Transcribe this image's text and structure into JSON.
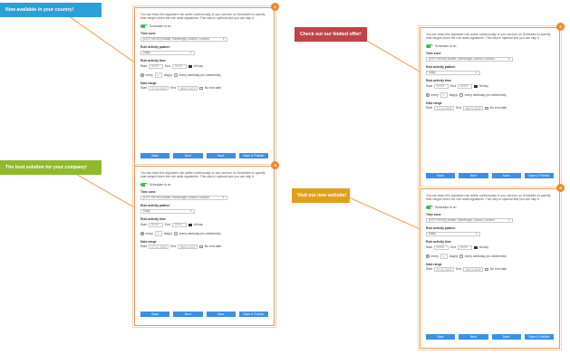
{
  "banners": [
    {
      "text": "Now available in your country!",
      "color": "#2a9fd8"
    },
    {
      "text": "Check out our limited offer!",
      "color": "#c0424a"
    },
    {
      "text": "The best solution for your company!",
      "color": "#8dbb2c"
    },
    {
      "text": "Visit our new website!",
      "color": "#e0a11a"
    }
  ],
  "accent_color": "#f08a24",
  "panels": [
    {
      "badge": "1"
    },
    {
      "badge": "2"
    },
    {
      "badge": "3"
    },
    {
      "badge": "4"
    }
  ],
  "form": {
    "intro": "You can keep this signature rule active continuously or you can turn on Scheduler to specify time ranges when the rule adds signatures. This step is optional and you can skip it.",
    "scheduler_label": "Scheduler is on",
    "timezone_label": "Time zone",
    "timezone_value": "(UTC+00:00) Dublin, Edinburgh, Lisbon, London",
    "pattern_label": "Rule activity pattern",
    "pattern_value": "Daily",
    "time_label": "Rule activity time",
    "start_label": "Start",
    "start_time": "00:00",
    "end_label": "End",
    "end_time": "00:00",
    "all_day_label": "All day",
    "every_label": "every",
    "every_value": "1",
    "days_label": "day(s)",
    "weekday_label": "every weekday (no weekends)",
    "date_label": "Date range",
    "date_start": "07.01.2022",
    "date_end": "08.01.2022",
    "no_end_label": "No end date",
    "buttons": [
      "Back",
      "Next",
      "Save",
      "Save & Publish"
    ]
  }
}
